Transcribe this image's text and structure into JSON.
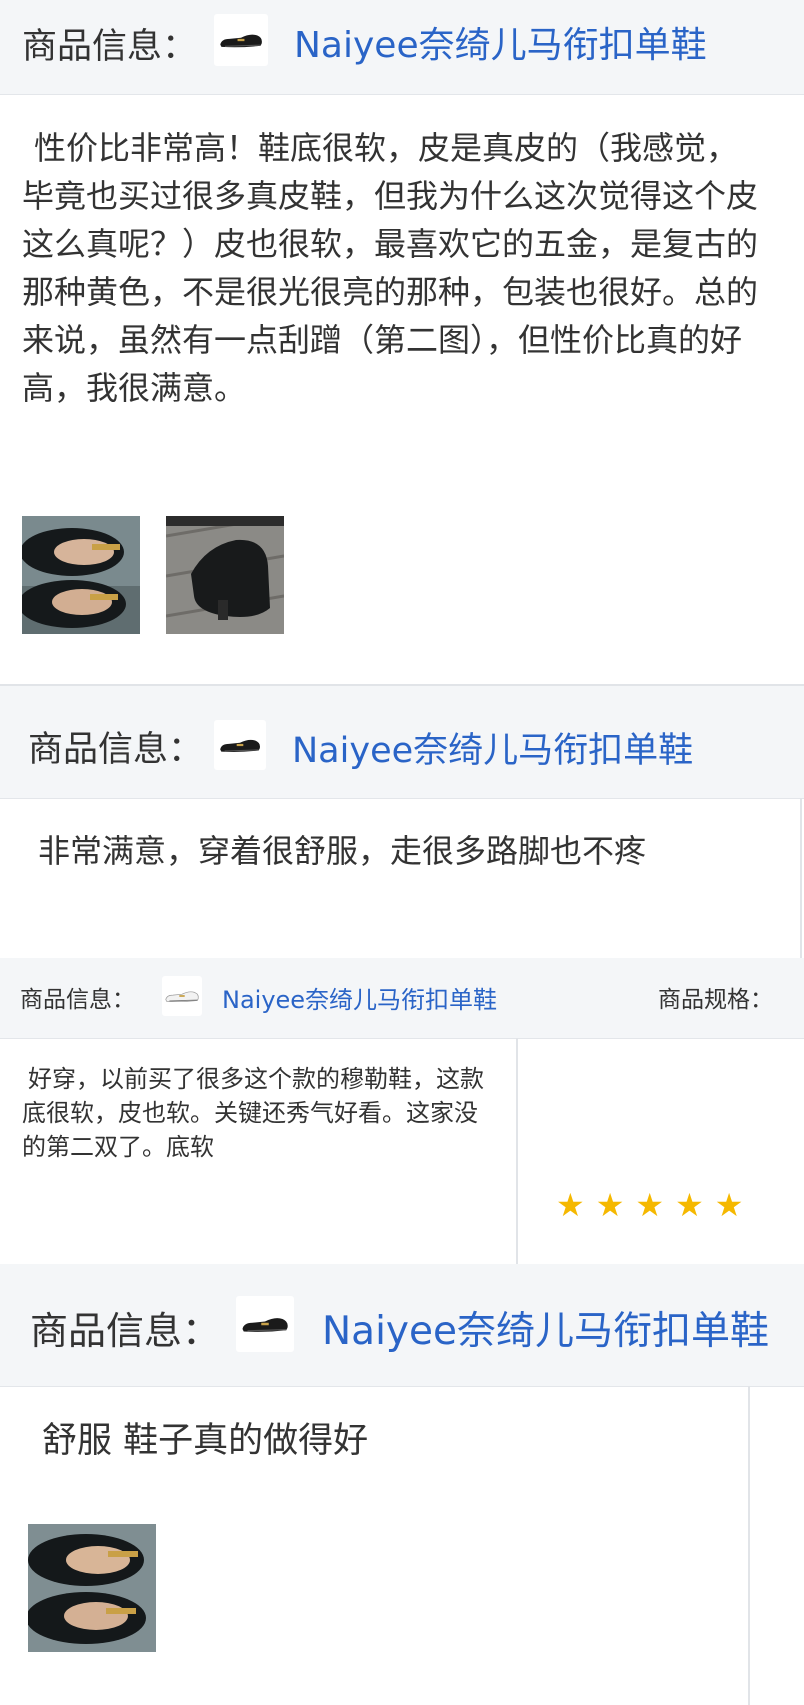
{
  "colors": {
    "link": "#2a64c7",
    "header_bg": "#f4f6f8",
    "star": "#f5b800",
    "text": "#333333"
  },
  "reviews": [
    {
      "product_label": "商品信息：",
      "product_name": "Naiyee奈绮儿马衔扣单鞋",
      "thumbnail_icon": "black-loafer-icon",
      "text": "性价比非常高！鞋底很软，皮是真皮的（我感觉，毕竟也买过很多真皮鞋，但我为什么这次觉得这个皮这么真呢？）皮也很软，最喜欢它的五金，是复古的那种黄色，不是很光很亮的那种，包装也很好。总的来说，虽然有一点刮蹭（第二图），但性价比真的好高，我很满意。",
      "photos": [
        "black-loafer-pair-photo",
        "black-loafer-side-photo"
      ]
    },
    {
      "product_label": "商品信息：",
      "product_name": "Naiyee奈绮儿马衔扣单鞋",
      "thumbnail_icon": "black-loafer-icon",
      "text": "非常满意，穿着很舒服，走很多路脚也不疼"
    },
    {
      "product_label": "商品信息：",
      "product_name": "Naiyee奈绮儿马衔扣单鞋",
      "spec_label": "商品规格：",
      "thumbnail_icon": "white-loafer-icon",
      "text": "好穿，以前买了很多这个款的穆勒鞋，这款底很软，皮也软。关键还秀气好看。这家没的第二双了。底软",
      "rating": 5,
      "stars": "★★★★★"
    },
    {
      "product_label": "商品信息：",
      "product_name": "Naiyee奈绮儿马衔扣单鞋",
      "thumbnail_icon": "black-loafer-icon",
      "text": "舒服 鞋子真的做得好",
      "photos": [
        "black-loafer-pair-photo"
      ]
    }
  ]
}
